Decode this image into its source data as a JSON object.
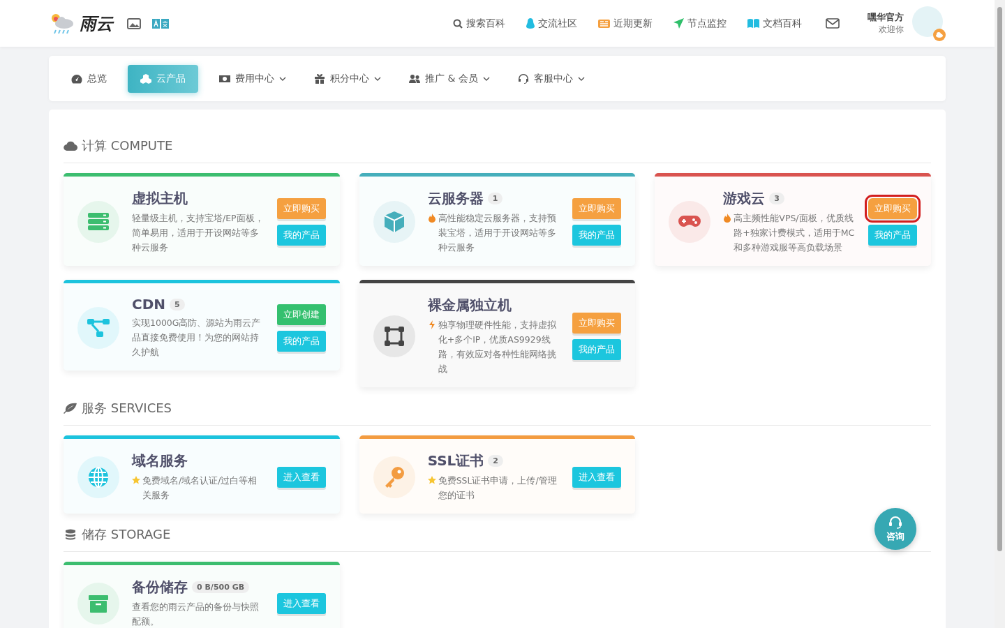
{
  "header": {
    "logo_text": "雨云",
    "links": [
      {
        "label": "搜索百科"
      },
      {
        "label": "交流社区"
      },
      {
        "label": "近期更新"
      },
      {
        "label": "节点监控"
      },
      {
        "label": "文档百科"
      }
    ],
    "user": {
      "name": "嘿华官方",
      "greeting": "欢迎你"
    }
  },
  "tabs": [
    {
      "label": "总览",
      "selected": false,
      "dropdown": false
    },
    {
      "label": "云产品",
      "selected": true,
      "dropdown": false
    },
    {
      "label": "费用中心",
      "selected": false,
      "dropdown": true
    },
    {
      "label": "积分中心",
      "selected": false,
      "dropdown": true
    },
    {
      "label": "推广 & 会员",
      "selected": false,
      "dropdown": true
    },
    {
      "label": "客服中心",
      "selected": false,
      "dropdown": true
    }
  ],
  "sections": [
    {
      "title": "计算 COMPUTE",
      "cards": [
        {
          "color": "#3cbd6f",
          "title": "虚拟主机",
          "description": "轻量级主机，支持宝塔/EP面板，简单易用，适用于开设网站等多种云服务",
          "buttons": [
            {
              "kind": "orange",
              "label": "立即购买",
              "circled": false
            },
            {
              "kind": "cyan",
              "label": "我的产品",
              "circled": false
            }
          ]
        },
        {
          "color": "#45aebb",
          "title": "云服务器",
          "badge": "1",
          "description": "高性能稳定云服务器，支持预装宝塔，适用于开设网站等多种云服务",
          "buttons": [
            {
              "kind": "orange",
              "label": "立即购买",
              "circled": false
            },
            {
              "kind": "cyan",
              "label": "我的产品",
              "circled": false
            }
          ]
        },
        {
          "color": "#d9534f",
          "title": "游戏云",
          "badge": "3",
          "description": "高主频性能VPS/面板，优质线路+独家计费模式，适用于MC和多种游戏服等高负载场景",
          "buttons": [
            {
              "kind": "orange",
              "label": "立即购买",
              "circled": true
            },
            {
              "kind": "cyan",
              "label": "我的产品",
              "circled": false
            }
          ]
        },
        {
          "color": "#1cc3dd",
          "title": "CDN",
          "badge": "5",
          "description": "实现1000G高防、源站为雨云产品直接免费使用！为您的网站持久护航",
          "buttons": [
            {
              "kind": "green",
              "label": "立即创建",
              "circled": false
            },
            {
              "kind": "cyan",
              "label": "我的产品",
              "circled": false
            }
          ]
        },
        {
          "color": "#444444",
          "title": "裸金属独立机",
          "description": "独享物理硬件性能，支持虚拟化+多个IP，优质AS9929线路，有效应对各种性能网络挑战",
          "buttons": [
            {
              "kind": "orange",
              "label": "立即购买",
              "circled": false
            },
            {
              "kind": "cyan",
              "label": "我的产品",
              "circled": false
            }
          ]
        }
      ]
    },
    {
      "title": "服务 SERVICES",
      "cards": [
        {
          "color": "#1cc3dd",
          "title": "域名服务",
          "description": "免费域名/域名认证/过白等相关服务",
          "buttons": [
            {
              "kind": "cyan",
              "label": "进入查看",
              "circled": false
            }
          ]
        },
        {
          "color": "#f39c41",
          "title": "SSL证书",
          "badge": "2",
          "description": "免费SSL证书申请，上传/管理您的证书",
          "buttons": [
            {
              "kind": "cyan",
              "label": "进入查看",
              "circled": false
            }
          ]
        }
      ]
    },
    {
      "title": "储存 STORAGE",
      "cards": [
        {
          "color": "#3cbd6f",
          "title": "备份储存",
          "badge": "0 B/500 GB",
          "description": "查看您的雨云产品的备份与快照配额。",
          "buttons": [
            {
              "kind": "cyan",
              "label": "进入查看",
              "circled": false
            }
          ]
        }
      ]
    }
  ],
  "consult_button": {
    "label": "咨询"
  }
}
